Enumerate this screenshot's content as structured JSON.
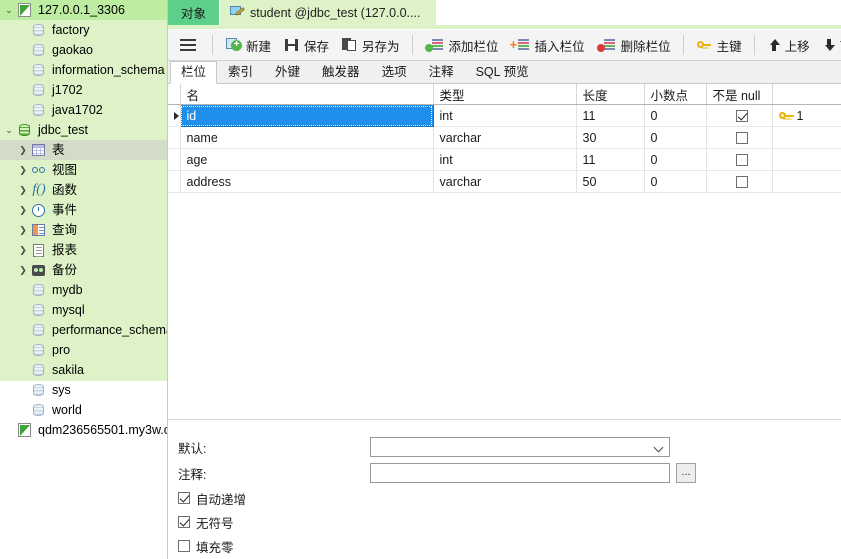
{
  "sidebar": {
    "connection": {
      "label": "127.0.0.1_3306",
      "icon": "connection-icon"
    },
    "databases_before": [
      {
        "label": "factory"
      },
      {
        "label": "gaokao"
      },
      {
        "label": "information_schema"
      },
      {
        "label": "j1702"
      },
      {
        "label": "java1702"
      }
    ],
    "active_db": {
      "label": "jdbc_test",
      "expanded": true
    },
    "active_db_children": [
      {
        "label": "表",
        "icon": "table-grid-icon",
        "selected": true
      },
      {
        "label": "视图",
        "icon": "view-icon",
        "selected": false
      },
      {
        "label": "函数",
        "icon": "function-icon",
        "selected": false
      },
      {
        "label": "事件",
        "icon": "event-clock-icon",
        "selected": false
      },
      {
        "label": "查询",
        "icon": "query-icon",
        "selected": false
      },
      {
        "label": "报表",
        "icon": "report-icon",
        "selected": false
      },
      {
        "label": "备份",
        "icon": "backup-icon",
        "selected": false
      }
    ],
    "databases_after": [
      {
        "label": "mydb"
      },
      {
        "label": "mysql"
      },
      {
        "label": "performance_schema"
      },
      {
        "label": "pro"
      },
      {
        "label": "sakila"
      },
      {
        "label": "sys"
      },
      {
        "label": "world"
      }
    ],
    "other_connection": {
      "label": "qdm236565501.my3w.c",
      "icon": "connection-icon"
    }
  },
  "window_tabs": [
    {
      "label": "对象",
      "active": true
    },
    {
      "label": "student @jdbc_test (127.0.0....",
      "active": false,
      "icon": "design-table-icon"
    }
  ],
  "toolbar": {
    "menu_icon": "hamburger-icon",
    "buttons": [
      {
        "label": "新建",
        "icon": "new-field-icon"
      },
      {
        "label": "保存",
        "icon": "save-icon"
      },
      {
        "label": "另存为",
        "icon": "save-as-icon"
      },
      {
        "label": "添加栏位",
        "icon": "add-field-icon"
      },
      {
        "label": "插入栏位",
        "icon": "insert-field-icon"
      },
      {
        "label": "删除栏位",
        "icon": "delete-field-icon"
      },
      {
        "label": "主键",
        "icon": "primary-key-icon"
      },
      {
        "label": "上移",
        "icon": "move-up-icon"
      },
      {
        "label": "下移",
        "icon": "move-down-icon"
      }
    ]
  },
  "inner_tabs": [
    {
      "label": "栏位",
      "active": true
    },
    {
      "label": "索引",
      "active": false
    },
    {
      "label": "外键",
      "active": false
    },
    {
      "label": "触发器",
      "active": false
    },
    {
      "label": "选项",
      "active": false
    },
    {
      "label": "注释",
      "active": false
    },
    {
      "label": "SQL 预览",
      "active": false
    }
  ],
  "grid": {
    "columns": [
      "名",
      "类型",
      "长度",
      "小数点",
      "不是 null",
      ""
    ],
    "rows": [
      {
        "selected": true,
        "name": "id",
        "type": "int",
        "length": "11",
        "decimals": "0",
        "not_null": true,
        "key": "1"
      },
      {
        "selected": false,
        "name": "name",
        "type": "varchar",
        "length": "30",
        "decimals": "0",
        "not_null": false,
        "key": ""
      },
      {
        "selected": false,
        "name": "age",
        "type": "int",
        "length": "11",
        "decimals": "0",
        "not_null": false,
        "key": ""
      },
      {
        "selected": false,
        "name": "address",
        "type": "varchar",
        "length": "50",
        "decimals": "0",
        "not_null": false,
        "key": ""
      }
    ]
  },
  "properties": {
    "default_label": "默认:",
    "default_value": "",
    "comment_label": "注释:",
    "comment_value": "",
    "browse_button": "...",
    "checkboxes": [
      {
        "label": "自动递增",
        "checked": true
      },
      {
        "label": "无符号",
        "checked": true
      },
      {
        "label": "填充零",
        "checked": false
      }
    ]
  },
  "colors": {
    "sidebar_bg": "#ddf3c7",
    "connection_row_bg": "#bdeda0",
    "active_tab_bg": "#5cd08a",
    "doc_tab_bg": "#ddf3c7",
    "selection_blue": "#1f8feb",
    "toolbar_bg": "#f4f4f4",
    "key_gold": "#e8b312"
  }
}
